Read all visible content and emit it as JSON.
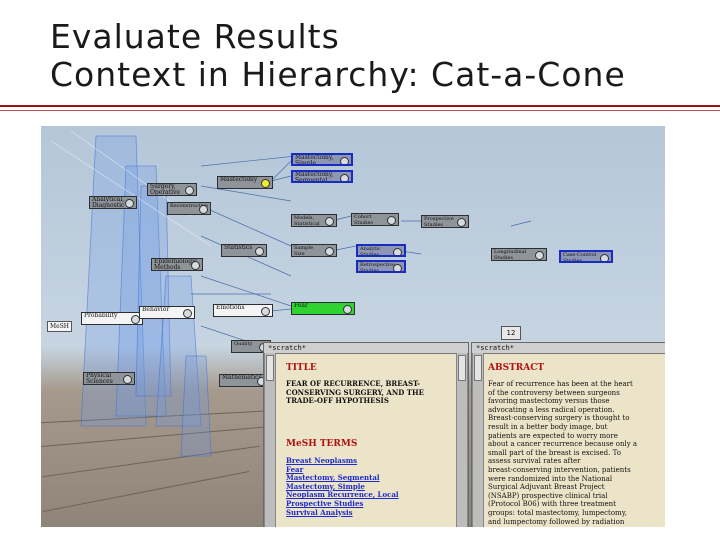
{
  "slide": {
    "title_line1": "Evaluate Results",
    "title_line2": "Context in Hierarchy: Cat-a-Cone",
    "accent_color": "#a01010"
  },
  "tree": {
    "nodes": [
      {
        "id": "n1",
        "label": "Mastectomy, Simple"
      },
      {
        "id": "n2",
        "label": "Mastectomy, Segmental"
      },
      {
        "id": "n3",
        "label": "Mastectomy"
      },
      {
        "id": "n4",
        "label": "Surgery, Operative"
      },
      {
        "id": "n5",
        "label": "Analytical, Diagnostic"
      },
      {
        "id": "n6",
        "label": "Reconstructive"
      },
      {
        "id": "n7",
        "label": "Epidemiologic Methods"
      },
      {
        "id": "n8",
        "label": "Statistics"
      },
      {
        "id": "n9",
        "label": "Probability"
      },
      {
        "id": "n10",
        "label": "Behavior"
      },
      {
        "id": "n11",
        "label": "Emotions"
      },
      {
        "id": "n12",
        "label": "Fear"
      },
      {
        "id": "n13",
        "label": "Physical Sciences"
      },
      {
        "id": "n14",
        "label": "Mathematics"
      },
      {
        "id": "n15",
        "label": "Models, Statistical"
      },
      {
        "id": "n16",
        "label": "Cohort Studies"
      },
      {
        "id": "n17",
        "label": "Prospective Studies"
      },
      {
        "id": "n18",
        "label": "Longitudinal Studies"
      },
      {
        "id": "n19",
        "label": "Case-Control Studies"
      },
      {
        "id": "n20",
        "label": "Sample Size"
      },
      {
        "id": "n21",
        "label": "Analytic Studies"
      },
      {
        "id": "n22",
        "label": "Retrospective Studies"
      },
      {
        "id": "n23",
        "label": "Quality"
      }
    ],
    "mesh_label": "MeSH",
    "page_badge": "12"
  },
  "left_panel": {
    "header": "*scratch*",
    "title_heading": "TITLE",
    "title_text": "FEAR OF RECURRENCE, BREAST-CONSERVING SURGERY, AND THE TRADE-OFF HYPOTHESIS",
    "mesh_heading": "MeSH TERMS",
    "mesh_terms": [
      "Breast Neoplasms",
      "Fear",
      "Mastectomy, Segmental",
      "Mastectomy, Simple",
      "Neoplasm Recurrence, Local",
      "Prospective Studies",
      "Survival Analysis"
    ]
  },
  "right_panel": {
    "header": "*scratch*",
    "abstract_heading": "ABSTRACT",
    "abstract_lines": [
      "Fear of recurrence has been at the heart",
      "of the controversy between surgeons",
      "favoring mastectomy versus those",
      "advocating a less radical operation.",
      "Breast-conserving surgery is thought to",
      "result in a better body image, but",
      "patients are expected to worry more",
      "about a cancer recurrence because only a",
      "small part of the breast is excised. To",
      "assess survival rates after",
      "breast-conserving intervention, patients",
      "were randomized into the National",
      "Surgical Adjuvant Breast Project",
      "(NSABP) prospective clinical trial",
      "(Protocol B06) with three treatment",
      "groups: total mastectomy, lumpectomy,",
      "and lumpectomy followed by radiation"
    ]
  }
}
